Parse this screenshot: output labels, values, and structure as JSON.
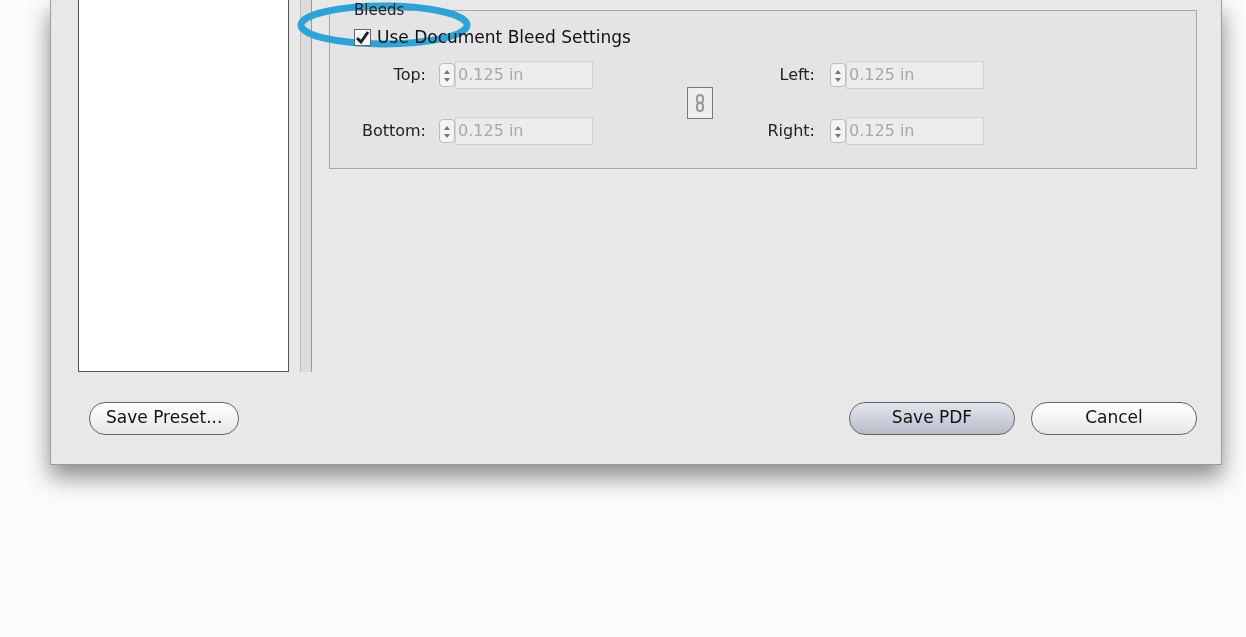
{
  "bleeds": {
    "title": "Bleeds",
    "use_document": {
      "label": "Use Document Bleed Settings",
      "checked": true
    },
    "fields": [
      {
        "label": "Top:",
        "value": "0.125 in",
        "disabled": true
      },
      {
        "label": "Left:",
        "value": "0.125 in",
        "disabled": true
      },
      {
        "label": "Bottom:",
        "value": "0.125 in",
        "disabled": true
      },
      {
        "label": "Right:",
        "value": "0.125 in",
        "disabled": true
      }
    ]
  },
  "buttons": [
    {
      "label": "Save Preset...",
      "default": false
    },
    {
      "label": "Save PDF",
      "default": true
    },
    {
      "label": "Cancel",
      "default": false
    }
  ]
}
